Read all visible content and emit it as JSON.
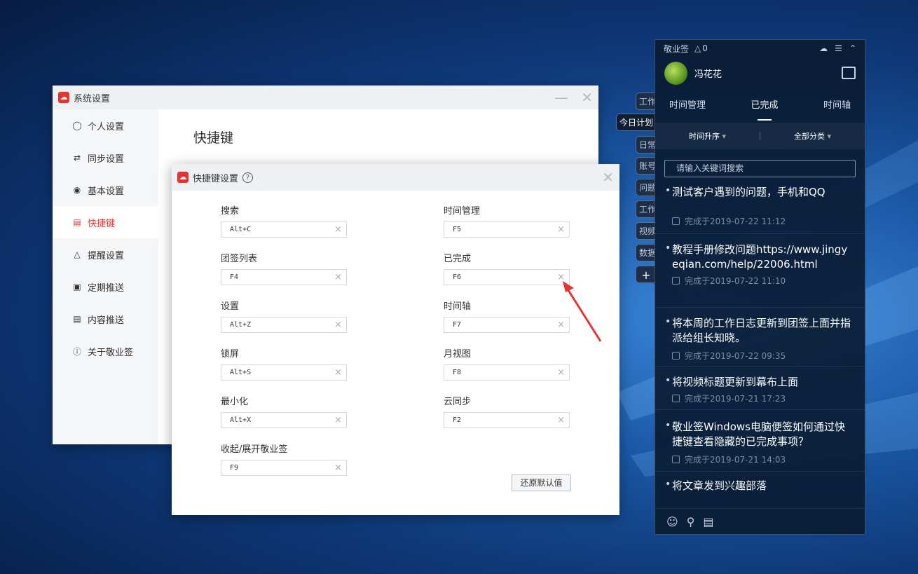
{
  "settings": {
    "title": "系统设置",
    "page_title": "快捷键",
    "menu": [
      {
        "label": "个人设置",
        "icon": "person-icon"
      },
      {
        "label": "同步设置",
        "icon": "sync-icon"
      },
      {
        "label": "基本设置",
        "icon": "settings-circle-icon"
      },
      {
        "label": "快捷键",
        "icon": "keyboard-icon"
      },
      {
        "label": "提醒设置",
        "icon": "bell-icon"
      },
      {
        "label": "定期推送",
        "icon": "schedule-icon"
      },
      {
        "label": "内容推送",
        "icon": "document-icon"
      },
      {
        "label": "关于敬业签",
        "icon": "info-icon"
      }
    ]
  },
  "shortcut": {
    "title": "快捷键设置",
    "help_icon": "?",
    "fields": [
      {
        "label": "搜索",
        "value": "Alt+C"
      },
      {
        "label": "时间管理",
        "value": "F5"
      },
      {
        "label": "团签列表",
        "value": "F4"
      },
      {
        "label": "已完成",
        "value": "F6"
      },
      {
        "label": "设置",
        "value": "Alt+Z"
      },
      {
        "label": "时间轴",
        "value": "F7"
      },
      {
        "label": "锁屏",
        "value": "Alt+S"
      },
      {
        "label": "月视图",
        "value": "F8"
      },
      {
        "label": "最小化",
        "value": "Alt+X"
      },
      {
        "label": "云同步",
        "value": "F2"
      },
      {
        "label": "收起/展开敬业签",
        "value": "F9"
      }
    ],
    "reset_label": "还原默认值",
    "clear_glyph": "×"
  },
  "side_tabs": [
    "工作",
    "今日计划",
    "日常",
    "账号",
    "问题",
    "工作",
    "视频",
    "数据",
    "+"
  ],
  "panel": {
    "app_name": "敬业签",
    "bell_count": "0",
    "username": "冯花花",
    "tabs": [
      "时间管理",
      "已完成",
      "时间轴"
    ],
    "active_tab": "已完成",
    "sort_label": "时间升序",
    "category_label": "全部分类",
    "search_placeholder": "请输入关键词搜索",
    "items": [
      {
        "text": "测试客户遇到的问题，手机和QQ",
        "meta": "完成于2019-07-22 11:12"
      },
      {
        "text": "教程手册修改问题https://www.jingyeqian.com/help/22006.html",
        "meta": "完成于2019-07-22 11:10"
      },
      {
        "text": "将本周的工作日志更新到团签上面并指派给组长知晓。",
        "meta": "完成于2019-07-22 09:35"
      },
      {
        "text": "将视频标题更新到幕布上面",
        "meta": "完成于2019-07-21 17:23"
      },
      {
        "text": "敬业签Windows电脑便签如何通过快捷键查看隐藏的已完成事项？",
        "meta": "完成于2019-07-21 14:03"
      },
      {
        "text": "将文章发到兴趣部落",
        "meta": ""
      }
    ]
  },
  "colors": {
    "accent": "#e8322f",
    "panel_bg": "#0a1c34"
  }
}
